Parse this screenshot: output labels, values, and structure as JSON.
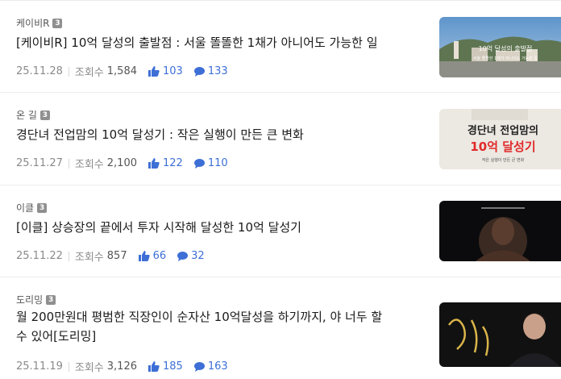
{
  "posts": [
    {
      "author": "케이비R",
      "level": "3",
      "title": "[케이비R] 10억 달성의 출발점 : 서울 똘똘한 1채가 아니어도 가능한 일",
      "date": "25.11.28",
      "views_label": "조회수",
      "views": "1,584",
      "likes": "103",
      "comments": "133",
      "thumb": {
        "line1": "10억 달성의 출발점",
        "line2": "서울 똘똘한 1채가 아니어도 가능한 일"
      }
    },
    {
      "author": "온 길",
      "level": "3",
      "title": "경단녀 전업맘의 10억 달성기 : 작은 실행이 만든 큰 변화",
      "date": "25.11.27",
      "views_label": "조회수",
      "views": "2,100",
      "likes": "122",
      "comments": "110",
      "thumb": {
        "line1": "경단녀 전업맘의",
        "line2": "10억 달성기",
        "line3": "작은 실행이 만든 큰 변화"
      }
    },
    {
      "author": "이클",
      "level": "3",
      "title": "[이클] 상승장의 끝에서 투자 시작해 달성한 10억 달성기",
      "date": "25.11.22",
      "views_label": "조회수",
      "views": "857",
      "likes": "66",
      "comments": "32"
    },
    {
      "author": "도리밍",
      "level": "3",
      "title": "월 200만원대 평범한 직장인이 순자산 10억달성을 하기까지, 야 너두 할 수 있어[도리밍]",
      "date": "25.11.19",
      "views_label": "조회수",
      "views": "3,126",
      "likes": "185",
      "comments": "163"
    }
  ],
  "colors": {
    "accent": "#3d6fd6",
    "meta": "#8a8a8a",
    "badge": "#8f8f8f"
  },
  "icons": {
    "like": "thumbs-up-icon",
    "comment": "speech-bubble-icon"
  }
}
